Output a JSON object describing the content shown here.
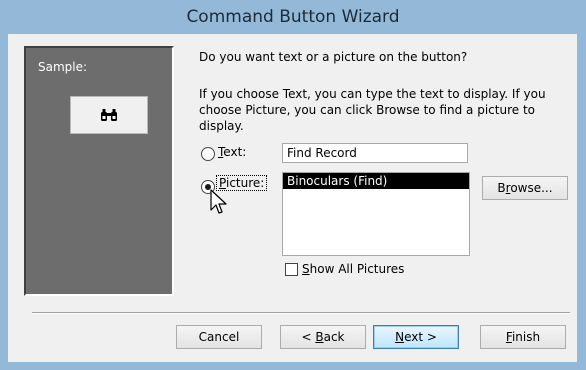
{
  "window": {
    "title": "Command Button Wizard"
  },
  "sample": {
    "label": "Sample:",
    "icon": "binoculars-icon"
  },
  "prompt": "Do you want text or a picture on the button?",
  "help": "If you choose Text, you can type the text to display.  If you choose Picture, you can click Browse to find a picture to display.",
  "options": {
    "text": {
      "accel": "T",
      "rest": "ext:",
      "value": "Find Record",
      "selected": false
    },
    "picture": {
      "accel": "P",
      "rest": "icture:",
      "selected": true
    }
  },
  "pictures": {
    "items": [
      "Binoculars (Find)"
    ],
    "selected": "Binoculars (Find)"
  },
  "browse": {
    "pre": "B",
    "accel": "r",
    "post": "owse..."
  },
  "show_all": {
    "accel": "S",
    "rest": "how All Pictures",
    "checked": false
  },
  "buttons": {
    "cancel": "Cancel",
    "back": {
      "pre": "< ",
      "accel": "B",
      "post": "ack"
    },
    "next": {
      "accel": "N",
      "post": "ext >"
    },
    "finish": {
      "accel": "F",
      "post": "inish"
    }
  }
}
